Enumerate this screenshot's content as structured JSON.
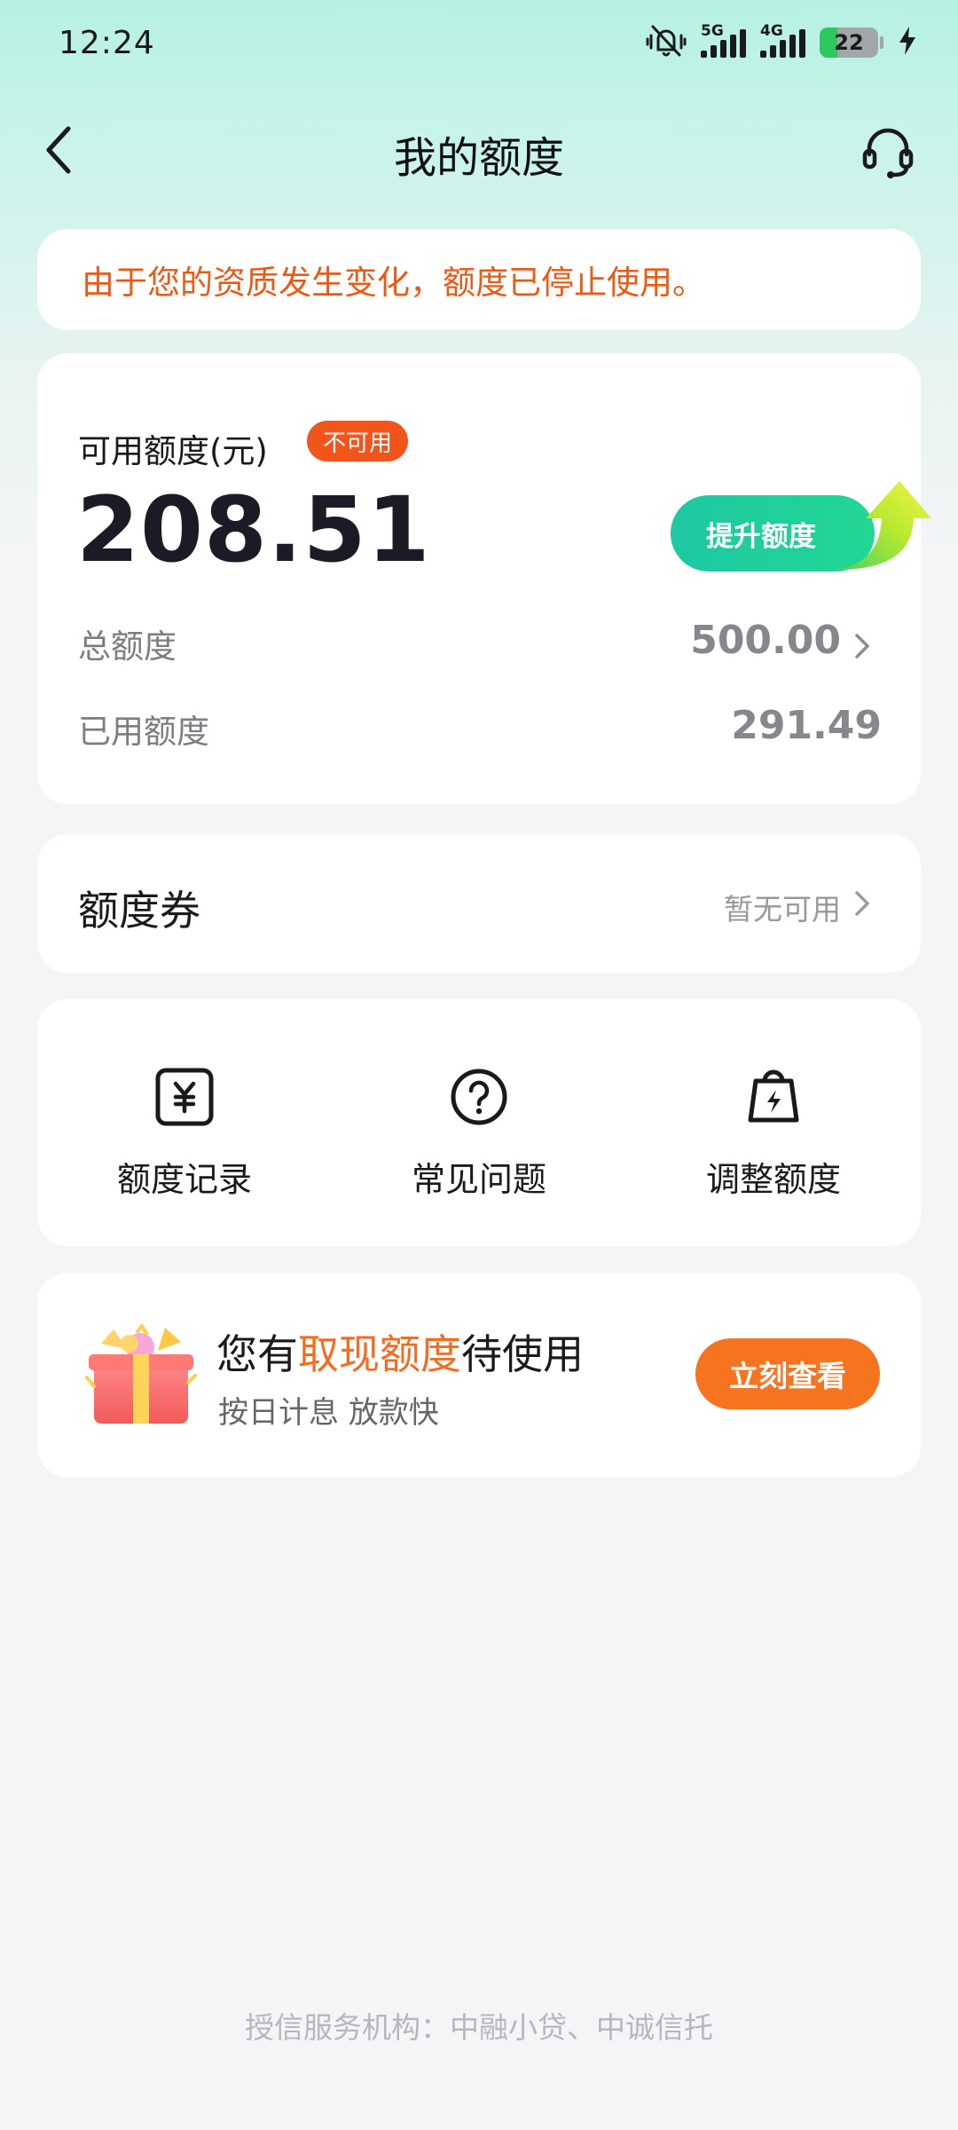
{
  "status_bar": {
    "time": "12:24",
    "network_1": "5G",
    "network_2": "4G",
    "battery": "22"
  },
  "nav": {
    "title": "我的额度"
  },
  "notice": {
    "text": "由于您的资质发生变化，额度已停止使用。"
  },
  "quota": {
    "available_label": "可用额度(元)",
    "status_badge": "不可用",
    "available_amount": "208.51",
    "raise_button": "提升额度",
    "total_label": "总额度",
    "total_value": "500.00",
    "used_label": "已用额度",
    "used_value": "291.49"
  },
  "coupon": {
    "title": "额度券",
    "status": "暂无可用"
  },
  "actions": [
    {
      "label": "额度记录",
      "icon": "yuan-receipt-icon"
    },
    {
      "label": "常见问题",
      "icon": "question-circle-icon"
    },
    {
      "label": "调整额度",
      "icon": "bag-lightning-icon"
    }
  ],
  "promo": {
    "title_prefix": "您有",
    "title_highlight": "取现额度",
    "title_suffix": "待使用",
    "subtitle": "按日计息 放款快",
    "button": "立刻查看"
  },
  "footer": {
    "text": "授信服务机构：中融小贷、中诚信托"
  },
  "colors": {
    "accent_green": "#1ec8a3",
    "warning_orange": "#ea5a14",
    "button_orange": "#f6741f"
  }
}
